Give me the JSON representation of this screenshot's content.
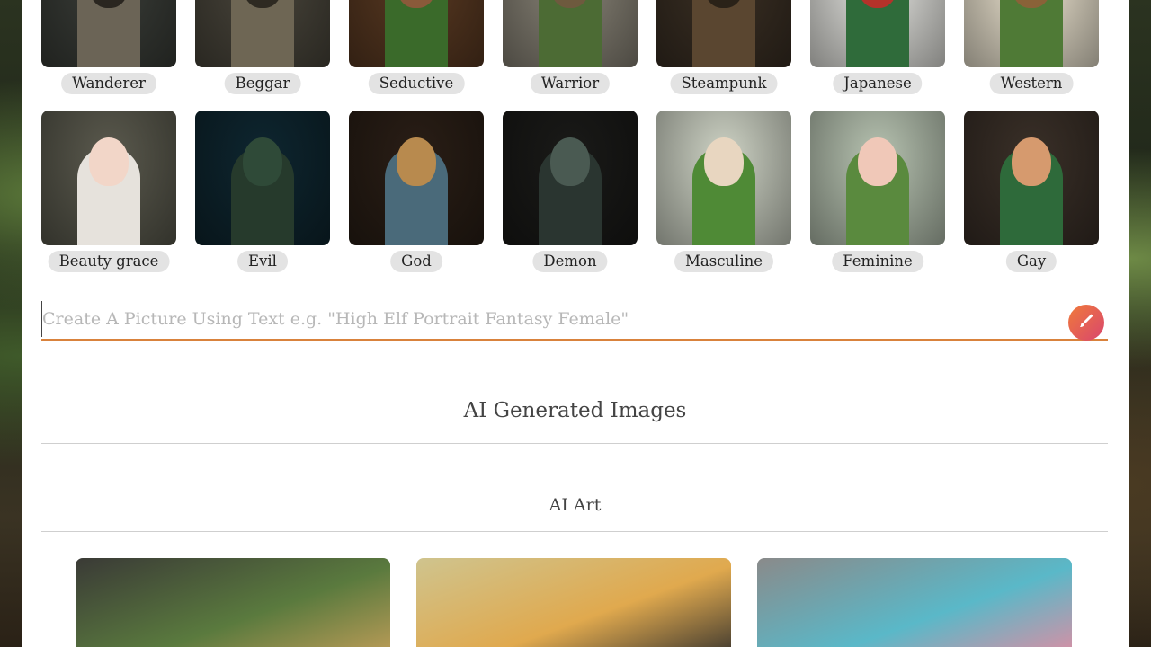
{
  "styles_row1": [
    {
      "label": "Wanderer",
      "colors": [
        "#3a3d38",
        "#6b6456",
        "#2a2620"
      ]
    },
    {
      "label": "Beggar",
      "colors": [
        "#4a463c",
        "#6e6654",
        "#2e2a22"
      ]
    },
    {
      "label": "Seductive",
      "colors": [
        "#5a3a22",
        "#3a6a2a",
        "#8a5a3a"
      ]
    },
    {
      "label": "Warrior",
      "colors": [
        "#8a8578",
        "#4c6b34",
        "#6e5a3e"
      ]
    },
    {
      "label": "Steampunk",
      "colors": [
        "#3b3024",
        "#5a4630",
        "#2a2218"
      ]
    },
    {
      "label": "Japanese",
      "colors": [
        "#e8e8e4",
        "#2f6b3a",
        "#b4322a"
      ]
    },
    {
      "label": "Western",
      "colors": [
        "#efe6d2",
        "#4f7a36",
        "#8a6238"
      ]
    }
  ],
  "styles_row2": [
    {
      "label": "Beauty grace",
      "colors": [
        "#5b5a4e",
        "#e6e2dc",
        "#f2d6c8"
      ]
    },
    {
      "label": "Evil",
      "colors": [
        "#0e2630",
        "#263a2c",
        "#2f4a38"
      ]
    },
    {
      "label": "God",
      "colors": [
        "#2a1e16",
        "#4a6a7a",
        "#b88a4e"
      ]
    },
    {
      "label": "Demon",
      "colors": [
        "#1a1a18",
        "#2a3530",
        "#4a5a52"
      ]
    },
    {
      "label": "Masculine",
      "colors": [
        "#cfd4c6",
        "#4f8a36",
        "#e8d6c0"
      ]
    },
    {
      "label": "Feminine",
      "colors": [
        "#b8c4b2",
        "#5a8a3e",
        "#f0c8b8"
      ]
    },
    {
      "label": "Gay",
      "colors": [
        "#3a3028",
        "#2e6a3a",
        "#d69a6e"
      ]
    }
  ],
  "prompt": {
    "placeholder": "Create A Picture Using Text e.g. \"High Elf Portrait Fantasy Female\""
  },
  "sections": {
    "generated_title": "AI Generated Images",
    "art_title": "AI Art"
  },
  "art_cards": [
    {
      "colors": [
        "#3a3a36",
        "#5a7a3e",
        "#c7a05a"
      ]
    },
    {
      "colors": [
        "#cfc48e",
        "#e0a94e",
        "#2c2c2c"
      ]
    },
    {
      "colors": [
        "#8a8a8a",
        "#5ab8c8",
        "#e88aa0"
      ]
    }
  ],
  "accent_colors": {
    "underline": "#d9823c",
    "brush_start": "#f07a3a",
    "brush_end": "#d9466e"
  }
}
